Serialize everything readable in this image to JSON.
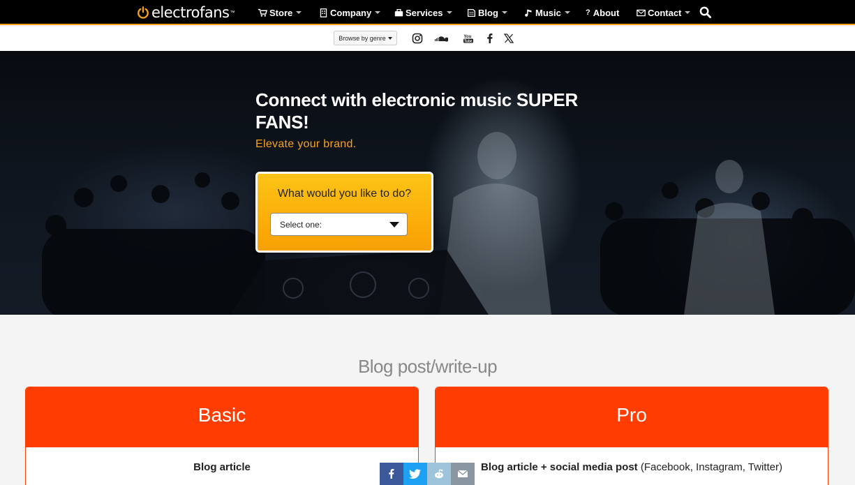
{
  "brand": {
    "name": "electrofans",
    "tm": "™",
    "accent": "#f7a21b",
    "power_icon": "power-icon"
  },
  "nav": {
    "items": [
      {
        "label": "Store",
        "icon": "cart-icon",
        "has_menu": true
      },
      {
        "label": "Company",
        "icon": "building-icon",
        "has_menu": true
      },
      {
        "label": "Services",
        "icon": "briefcase-icon",
        "has_menu": true
      },
      {
        "label": "Blog",
        "icon": "book-icon",
        "has_menu": true
      },
      {
        "label": "Music",
        "icon": "music-note-icon",
        "has_menu": true
      },
      {
        "label": "About",
        "icon": "question-icon",
        "has_menu": false
      },
      {
        "label": "Contact",
        "icon": "envelope-icon",
        "has_menu": true
      }
    ],
    "search_icon": "search-icon"
  },
  "subbar": {
    "genre_label": "Browse by genre",
    "social": [
      "instagram-icon",
      "soundcloud-icon",
      "youtube-icon",
      "facebook-icon",
      "x-icon"
    ]
  },
  "hero": {
    "title": "Connect with electronic music SUPER FANS!",
    "subtitle": "Elevate your brand.",
    "cta": {
      "question": "What would you like to do?",
      "select_value": "Select one:"
    }
  },
  "pricing": {
    "section_title": "Blog post/write-up",
    "plans": [
      {
        "name": "Basic",
        "feature_bold": "Blog article",
        "feature_extra": ""
      },
      {
        "name": "Pro",
        "feature_bold": "Blog article + social media post",
        "feature_extra": " (Facebook, Instagram, Twitter)"
      }
    ],
    "card_color": "#ff3d00"
  },
  "share_bar": [
    {
      "icon": "facebook-icon",
      "color": "#3b5998"
    },
    {
      "icon": "twitter-icon",
      "color": "#1da1f2"
    },
    {
      "icon": "reddit-icon",
      "color": "#9ec4dc"
    },
    {
      "icon": "email-icon",
      "color": "#8b96a3"
    }
  ]
}
